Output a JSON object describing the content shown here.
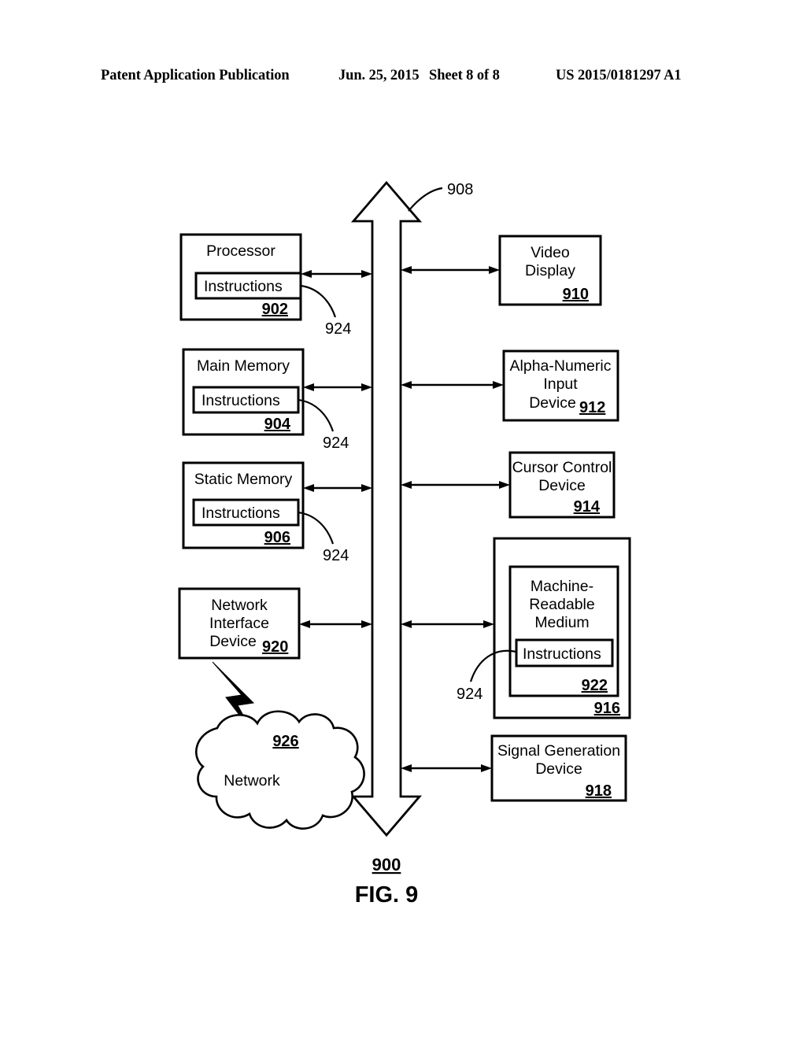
{
  "header": {
    "publication": "Patent Application Publication",
    "date": "Jun. 25, 2015",
    "sheet": "Sheet 8 of 8",
    "number": "US 2015/0181297 A1"
  },
  "figure": {
    "caption": "FIG. 9",
    "system_ref": "900",
    "bus_ref": "908",
    "blocks": [
      {
        "id": "processor",
        "lines": [
          "Processor"
        ],
        "ref": "902",
        "inner_label": "Instructions",
        "leader_ref": "924"
      },
      {
        "id": "main-memory",
        "lines": [
          "Main Memory"
        ],
        "ref": "904",
        "inner_label": "Instructions",
        "leader_ref": "924"
      },
      {
        "id": "static-memory",
        "lines": [
          "Static Memory"
        ],
        "ref": "906",
        "inner_label": "Instructions",
        "leader_ref": "924"
      },
      {
        "id": "network-interface-device",
        "lines": [
          "Network",
          "Interface",
          "Device"
        ],
        "ref": "920",
        "inner_label": null,
        "leader_ref": null
      },
      {
        "id": "video-display",
        "lines": [
          "Video",
          "Display"
        ],
        "ref": "910",
        "inner_label": null,
        "leader_ref": null
      },
      {
        "id": "alpha-numeric-input-device",
        "lines": [
          "Alpha-Numeric",
          "Input",
          "Device"
        ],
        "ref": "912",
        "inner_label": null,
        "leader_ref": null
      },
      {
        "id": "cursor-control-device",
        "lines": [
          "Cursor Control",
          "Device"
        ],
        "ref": "914",
        "inner_label": null,
        "leader_ref": null
      },
      {
        "id": "machine-readable-medium",
        "lines": [
          "Machine-",
          "Readable",
          "Medium"
        ],
        "ref": "922",
        "outer_ref": "916",
        "inner_label": "Instructions",
        "leader_ref": "924"
      },
      {
        "id": "signal-generation-device",
        "lines": [
          "Signal Generation",
          "Device"
        ],
        "ref": "918",
        "inner_label": null,
        "leader_ref": null
      }
    ],
    "network": {
      "label": "Network",
      "ref": "926"
    }
  },
  "labels": {
    "processor_title": "Processor",
    "processor_ref": "902",
    "processor_instructions": "Instructions",
    "processor_leader": "924",
    "main_memory_title": "Main Memory",
    "main_memory_ref": "904",
    "main_memory_instructions": "Instructions",
    "main_memory_leader": "924",
    "static_memory_title": "Static Memory",
    "static_memory_ref": "906",
    "static_memory_instructions": "Instructions",
    "static_memory_leader": "924",
    "nid_line1": "Network",
    "nid_line2": "Interface",
    "nid_line3": "Device",
    "nid_ref": "920",
    "video_line1": "Video",
    "video_line2": "Display",
    "video_ref": "910",
    "ani_line1": "Alpha-Numeric",
    "ani_line2": "Input",
    "ani_line3": "Device",
    "ani_ref": "912",
    "cursor_line1": "Cursor Control",
    "cursor_line2": "Device",
    "cursor_ref": "914",
    "mrm_line1": "Machine-",
    "mrm_line2": "Readable",
    "mrm_line3": "Medium",
    "mrm_instructions": "Instructions",
    "mrm_ref": "922",
    "mrm_outer_ref": "916",
    "mrm_leader": "924",
    "sgd_line1": "Signal Generation",
    "sgd_line2": "Device",
    "sgd_ref": "918",
    "network_label": "Network",
    "network_ref": "926",
    "bus_ref": "908",
    "system_ref": "900",
    "caption": "FIG. 9"
  },
  "colors": {
    "ink": "#000000",
    "paper": "#ffffff"
  }
}
